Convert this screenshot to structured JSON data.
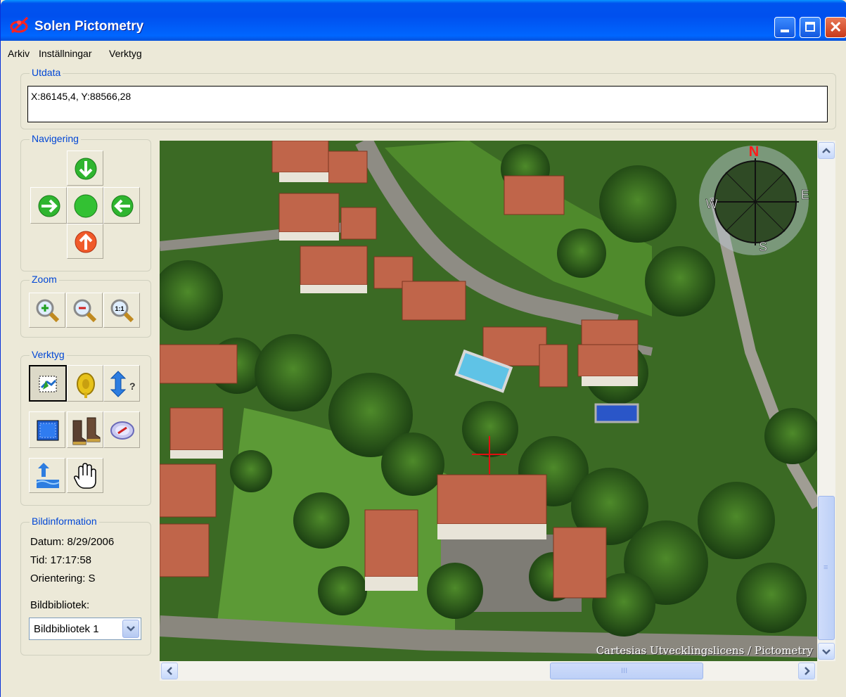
{
  "window": {
    "title": "Solen Pictometry"
  },
  "menu": [
    "Arkiv",
    "Inställningar",
    "Verktyg"
  ],
  "output": {
    "label": "Utdata",
    "value": "X:86145,4, Y:88566,28"
  },
  "navigation": {
    "label": "Navigering"
  },
  "zoom": {
    "label": "Zoom",
    "one_to_one": "1:1"
  },
  "tools": {
    "label": "Verktyg"
  },
  "image_info": {
    "label": "Bildinformation",
    "date": "Datum: 8/29/2006",
    "time": "Tid: 17:17:58",
    "orientation": "Orientering: S",
    "library_label": "Bildbibliotek:",
    "library_selected": "Bildbibliotek 1"
  },
  "photo": {
    "credit": "Cartesias Utvecklingslicens / Pictometry",
    "compass": {
      "n": "N",
      "e": "E",
      "s": "S",
      "w": "W"
    }
  },
  "colors": {
    "titlebar": "#0053ee",
    "accent_label": "#0046d5",
    "crosshair": "#e01010"
  }
}
